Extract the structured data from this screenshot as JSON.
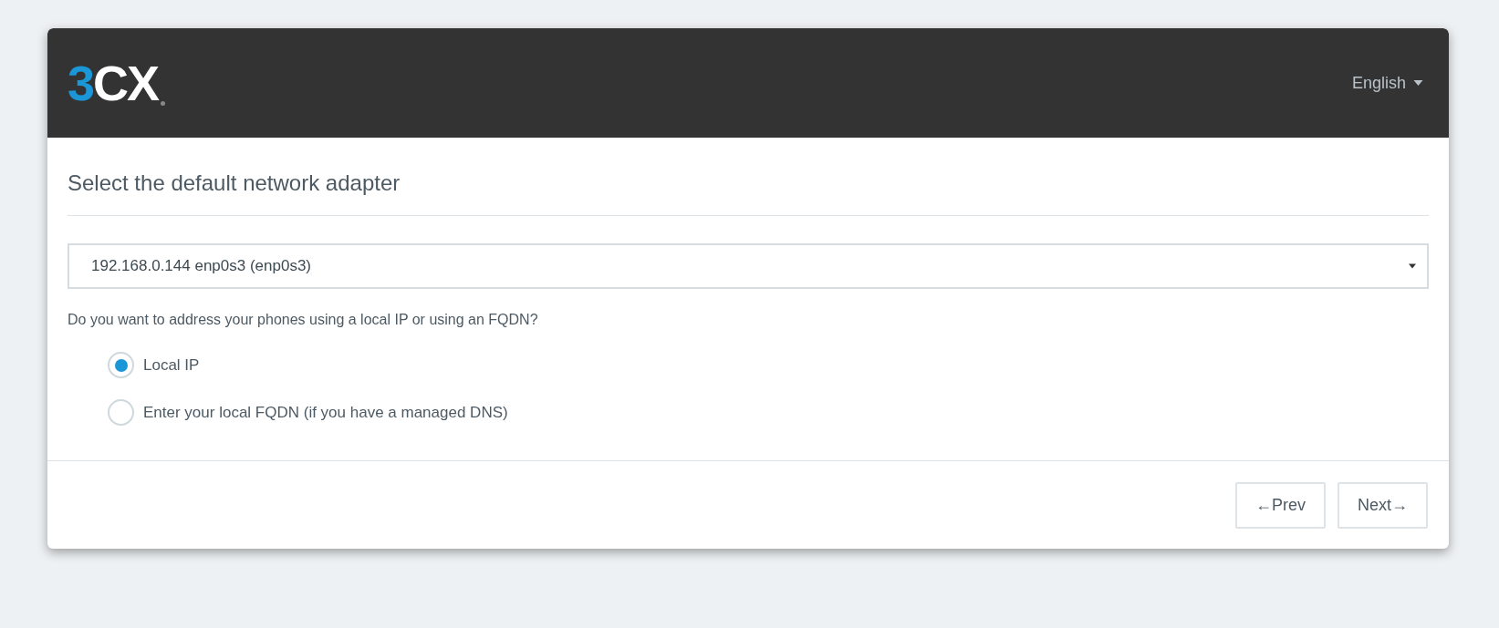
{
  "header": {
    "logo": {
      "accent": "3",
      "rest": "CX"
    },
    "language": "English"
  },
  "title": "Select the default network adapter",
  "adapter_select": {
    "value": "192.168.0.144 enp0s3 (enp0s3)"
  },
  "question": "Do you want to address your phones using a local IP or using an FQDN?",
  "options": [
    {
      "label": "Local IP",
      "selected": true
    },
    {
      "label": "Enter your local FQDN (if you have a managed DNS)",
      "selected": false
    }
  ],
  "buttons": [
    "←Prev",
    "Next→"
  ]
}
